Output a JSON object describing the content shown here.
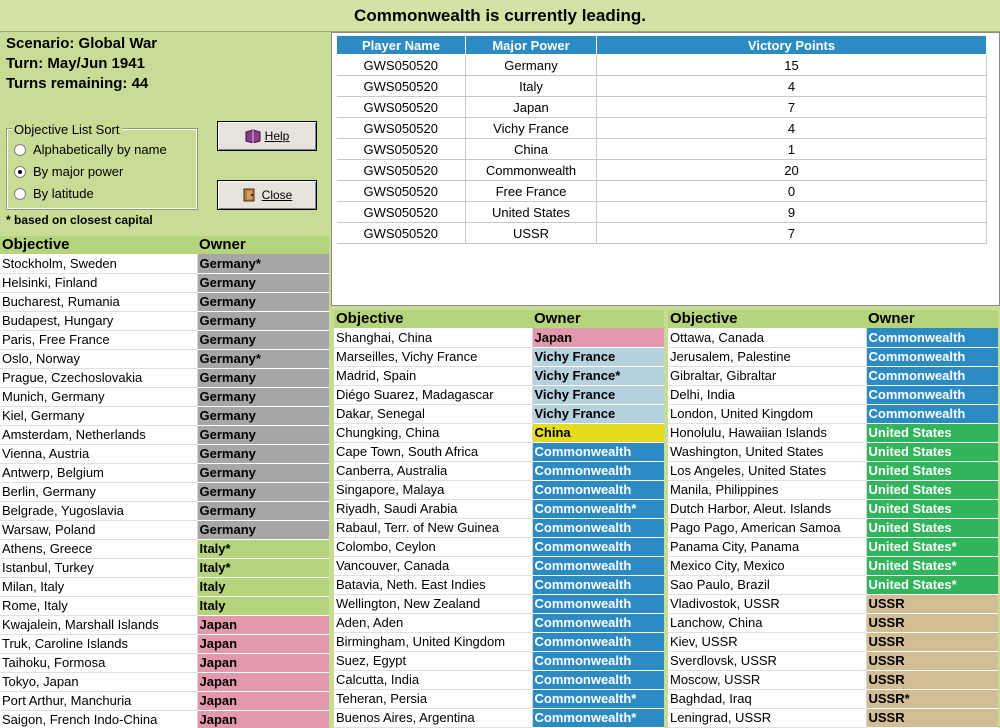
{
  "banner": "Commonwealth is currently leading.",
  "info": {
    "scenario": "Scenario: Global War",
    "turn": "Turn: May/Jun 1941",
    "turns_remaining": "Turns remaining: 44"
  },
  "sort": {
    "legend": "Objective List Sort",
    "options": [
      "Alphabetically by name",
      "By major power",
      "By latitude"
    ],
    "selected": "By major power"
  },
  "buttons": {
    "help": "Help",
    "close": "Close"
  },
  "note": "* based on closest capital",
  "colors": {
    "Germany": "#a6a6a6",
    "Italy": "#b5d47c",
    "Japan": "#e298ad",
    "Vichy France": "#b5d2de",
    "China": "#e6dc1e",
    "Commonwealth": "#2d8bc4",
    "United States": "#31b45c",
    "USSR": "#d2bd94"
  },
  "victory": {
    "headers": [
      "Player Name",
      "Major Power",
      "Victory Points"
    ],
    "rows": [
      [
        "GWS050520",
        "Germany",
        "15"
      ],
      [
        "GWS050520",
        "Italy",
        "4"
      ],
      [
        "GWS050520",
        "Japan",
        "7"
      ],
      [
        "GWS050520",
        "Vichy France",
        "4"
      ],
      [
        "GWS050520",
        "China",
        "1"
      ],
      [
        "GWS050520",
        "Commonwealth",
        "20"
      ],
      [
        "GWS050520",
        "Free France",
        "0"
      ],
      [
        "GWS050520",
        "United States",
        "9"
      ],
      [
        "GWS050520",
        "USSR",
        "7"
      ]
    ]
  },
  "obj_headers": {
    "objective": "Objective",
    "owner": "Owner"
  },
  "objectives1": [
    [
      "Stockholm, Sweden",
      "Germany*",
      "Germany"
    ],
    [
      "Helsinki, Finland",
      "Germany",
      "Germany"
    ],
    [
      "Bucharest, Rumania",
      "Germany",
      "Germany"
    ],
    [
      "Budapest, Hungary",
      "Germany",
      "Germany"
    ],
    [
      "Paris, Free France",
      "Germany",
      "Germany"
    ],
    [
      "Oslo, Norway",
      "Germany*",
      "Germany"
    ],
    [
      "Prague, Czechoslovakia",
      "Germany",
      "Germany"
    ],
    [
      "Munich, Germany",
      "Germany",
      "Germany"
    ],
    [
      "Kiel, Germany",
      "Germany",
      "Germany"
    ],
    [
      "Amsterdam, Netherlands",
      "Germany",
      "Germany"
    ],
    [
      "Vienna, Austria",
      "Germany",
      "Germany"
    ],
    [
      "Antwerp, Belgium",
      "Germany",
      "Germany"
    ],
    [
      "Berlin, Germany",
      "Germany",
      "Germany"
    ],
    [
      "Belgrade, Yugoslavia",
      "Germany",
      "Germany"
    ],
    [
      "Warsaw, Poland",
      "Germany",
      "Germany"
    ],
    [
      "Athens, Greece",
      "Italy*",
      "Italy"
    ],
    [
      "Istanbul, Turkey",
      "Italy*",
      "Italy"
    ],
    [
      "Milan, Italy",
      "Italy",
      "Italy"
    ],
    [
      "Rome, Italy",
      "Italy",
      "Italy"
    ],
    [
      "Kwajalein, Marshall Islands",
      "Japan",
      "Japan"
    ],
    [
      "Truk, Caroline Islands",
      "Japan",
      "Japan"
    ],
    [
      "Taihoku, Formosa",
      "Japan",
      "Japan"
    ],
    [
      "Tokyo, Japan",
      "Japan",
      "Japan"
    ],
    [
      "Port Arthur, Manchuria",
      "Japan",
      "Japan"
    ],
    [
      "Saigon, French Indo-China",
      "Japan",
      "Japan"
    ]
  ],
  "objectives2": [
    [
      "Shanghai, China",
      "Japan",
      "Japan"
    ],
    [
      "Marseilles, Vichy France",
      "Vichy France",
      "Vichy France"
    ],
    [
      "Madrid, Spain",
      "Vichy France*",
      "Vichy France"
    ],
    [
      "Diégo Suarez, Madagascar",
      "Vichy France",
      "Vichy France"
    ],
    [
      "Dakar, Senegal",
      "Vichy France",
      "Vichy France"
    ],
    [
      "Chungking, China",
      "China",
      "China"
    ],
    [
      "Cape Town, South Africa",
      "Commonwealth",
      "Commonwealth"
    ],
    [
      "Canberra, Australia",
      "Commonwealth",
      "Commonwealth"
    ],
    [
      "Singapore, Malaya",
      "Commonwealth",
      "Commonwealth"
    ],
    [
      "Riyadh, Saudi Arabia",
      "Commonwealth*",
      "Commonwealth"
    ],
    [
      "Rabaul, Terr. of New Guinea",
      "Commonwealth",
      "Commonwealth"
    ],
    [
      "Colombo, Ceylon",
      "Commonwealth",
      "Commonwealth"
    ],
    [
      "Vancouver, Canada",
      "Commonwealth",
      "Commonwealth"
    ],
    [
      "Batavia, Neth. East Indies",
      "Commonwealth",
      "Commonwealth"
    ],
    [
      "Wellington, New Zealand",
      "Commonwealth",
      "Commonwealth"
    ],
    [
      "Aden, Aden",
      "Commonwealth",
      "Commonwealth"
    ],
    [
      "Birmingham, United Kingdom",
      "Commonwealth",
      "Commonwealth"
    ],
    [
      "Suez, Egypt",
      "Commonwealth",
      "Commonwealth"
    ],
    [
      "Calcutta, India",
      "Commonwealth",
      "Commonwealth"
    ],
    [
      "Teheran, Persia",
      "Commonwealth*",
      "Commonwealth"
    ],
    [
      "Buenos Aires, Argentina",
      "Commonwealth*",
      "Commonwealth"
    ]
  ],
  "objectives3": [
    [
      "Ottawa, Canada",
      "Commonwealth",
      "Commonwealth"
    ],
    [
      "Jerusalem, Palestine",
      "Commonwealth",
      "Commonwealth"
    ],
    [
      "Gibraltar, Gibraltar",
      "Commonwealth",
      "Commonwealth"
    ],
    [
      "Delhi, India",
      "Commonwealth",
      "Commonwealth"
    ],
    [
      "London, United Kingdom",
      "Commonwealth",
      "Commonwealth"
    ],
    [
      "Honolulu, Hawaiian Islands",
      "United States",
      "United States"
    ],
    [
      "Washington, United States",
      "United States",
      "United States"
    ],
    [
      "Los Angeles, United States",
      "United States",
      "United States"
    ],
    [
      "Manila, Philippines",
      "United States",
      "United States"
    ],
    [
      "Dutch Harbor, Aleut. Islands",
      "United States",
      "United States"
    ],
    [
      "Pago Pago, American Samoa",
      "United States",
      "United States"
    ],
    [
      "Panama City, Panama",
      "United States*",
      "United States"
    ],
    [
      "Mexico City, Mexico",
      "United States*",
      "United States"
    ],
    [
      "Sao Paulo, Brazil",
      "United States*",
      "United States"
    ],
    [
      "Vladivostok, USSR",
      "USSR",
      "USSR"
    ],
    [
      "Lanchow, China",
      "USSR",
      "USSR"
    ],
    [
      "Kiev, USSR",
      "USSR",
      "USSR"
    ],
    [
      "Sverdlovsk, USSR",
      "USSR",
      "USSR"
    ],
    [
      "Moscow, USSR",
      "USSR",
      "USSR"
    ],
    [
      "Baghdad, Iraq",
      "USSR*",
      "USSR"
    ],
    [
      "Leningrad, USSR",
      "USSR",
      "USSR"
    ]
  ]
}
